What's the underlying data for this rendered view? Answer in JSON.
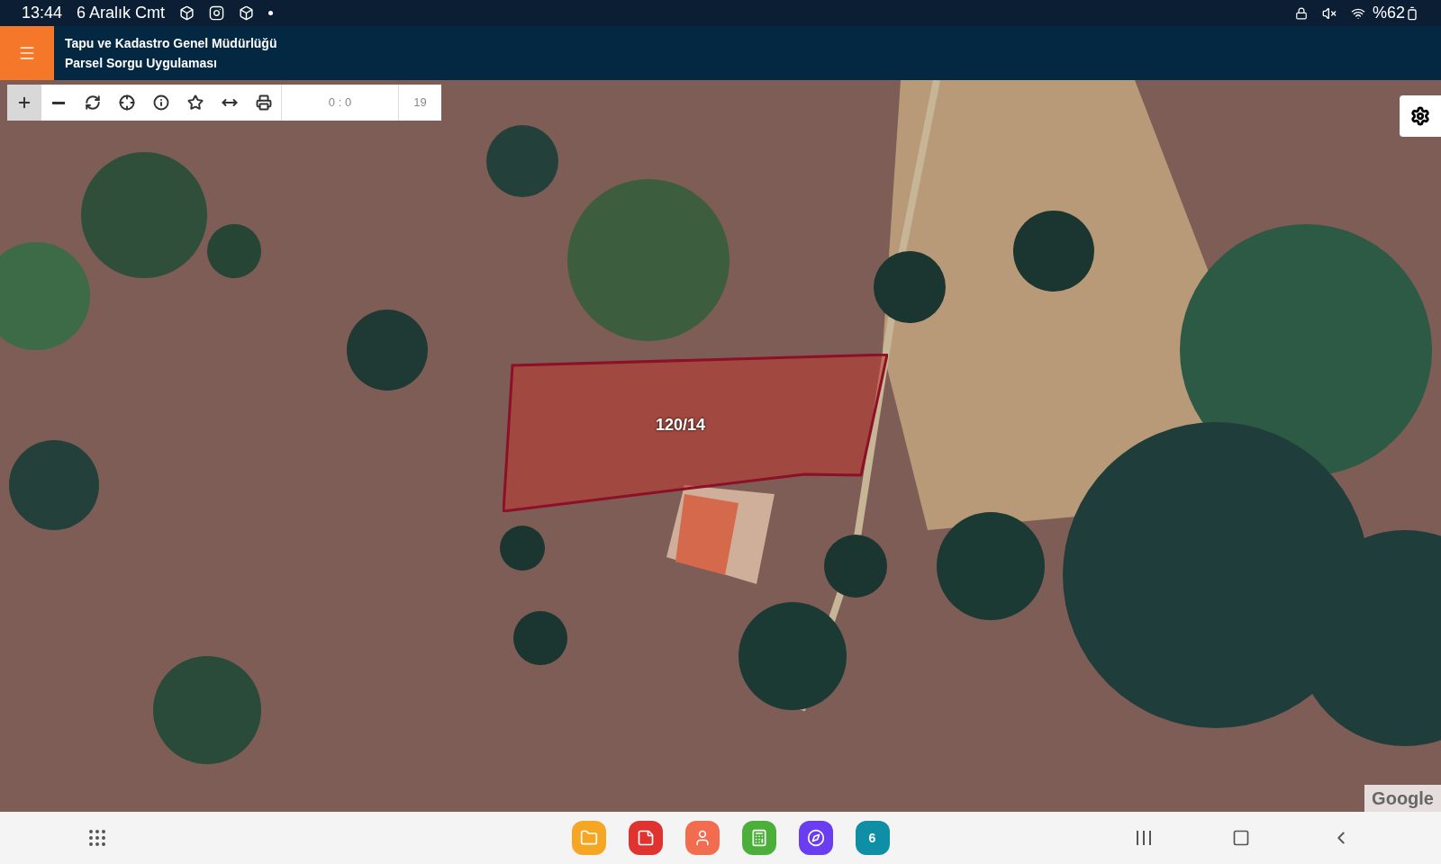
{
  "status_bar": {
    "time": "13:44",
    "date": "6 Aralık Cmt",
    "battery": "%62"
  },
  "header": {
    "title": "Tapu ve Kadastro Genel Müdürlüğü",
    "subtitle": "Parsel Sorgu Uygulaması"
  },
  "toolbar": {
    "tools": [
      {
        "kind": "zoom-in",
        "selected": true
      },
      {
        "kind": "zoom-out",
        "selected": false
      },
      {
        "kind": "refresh",
        "selected": false
      },
      {
        "kind": "locate",
        "selected": false
      },
      {
        "kind": "info",
        "selected": false
      },
      {
        "kind": "favorite",
        "selected": false
      },
      {
        "kind": "measure",
        "selected": false
      },
      {
        "kind": "print",
        "selected": false
      }
    ],
    "coordinates": "0 : 0",
    "zoom_level": "19"
  },
  "map": {
    "parcel_label": "120/14",
    "attribution": "Google"
  },
  "dock": {
    "apps": [
      {
        "kind": "files"
      },
      {
        "kind": "notes"
      },
      {
        "kind": "contacts"
      },
      {
        "kind": "calculator"
      },
      {
        "kind": "browser"
      },
      {
        "kind": "calendar",
        "label": "6"
      }
    ]
  }
}
